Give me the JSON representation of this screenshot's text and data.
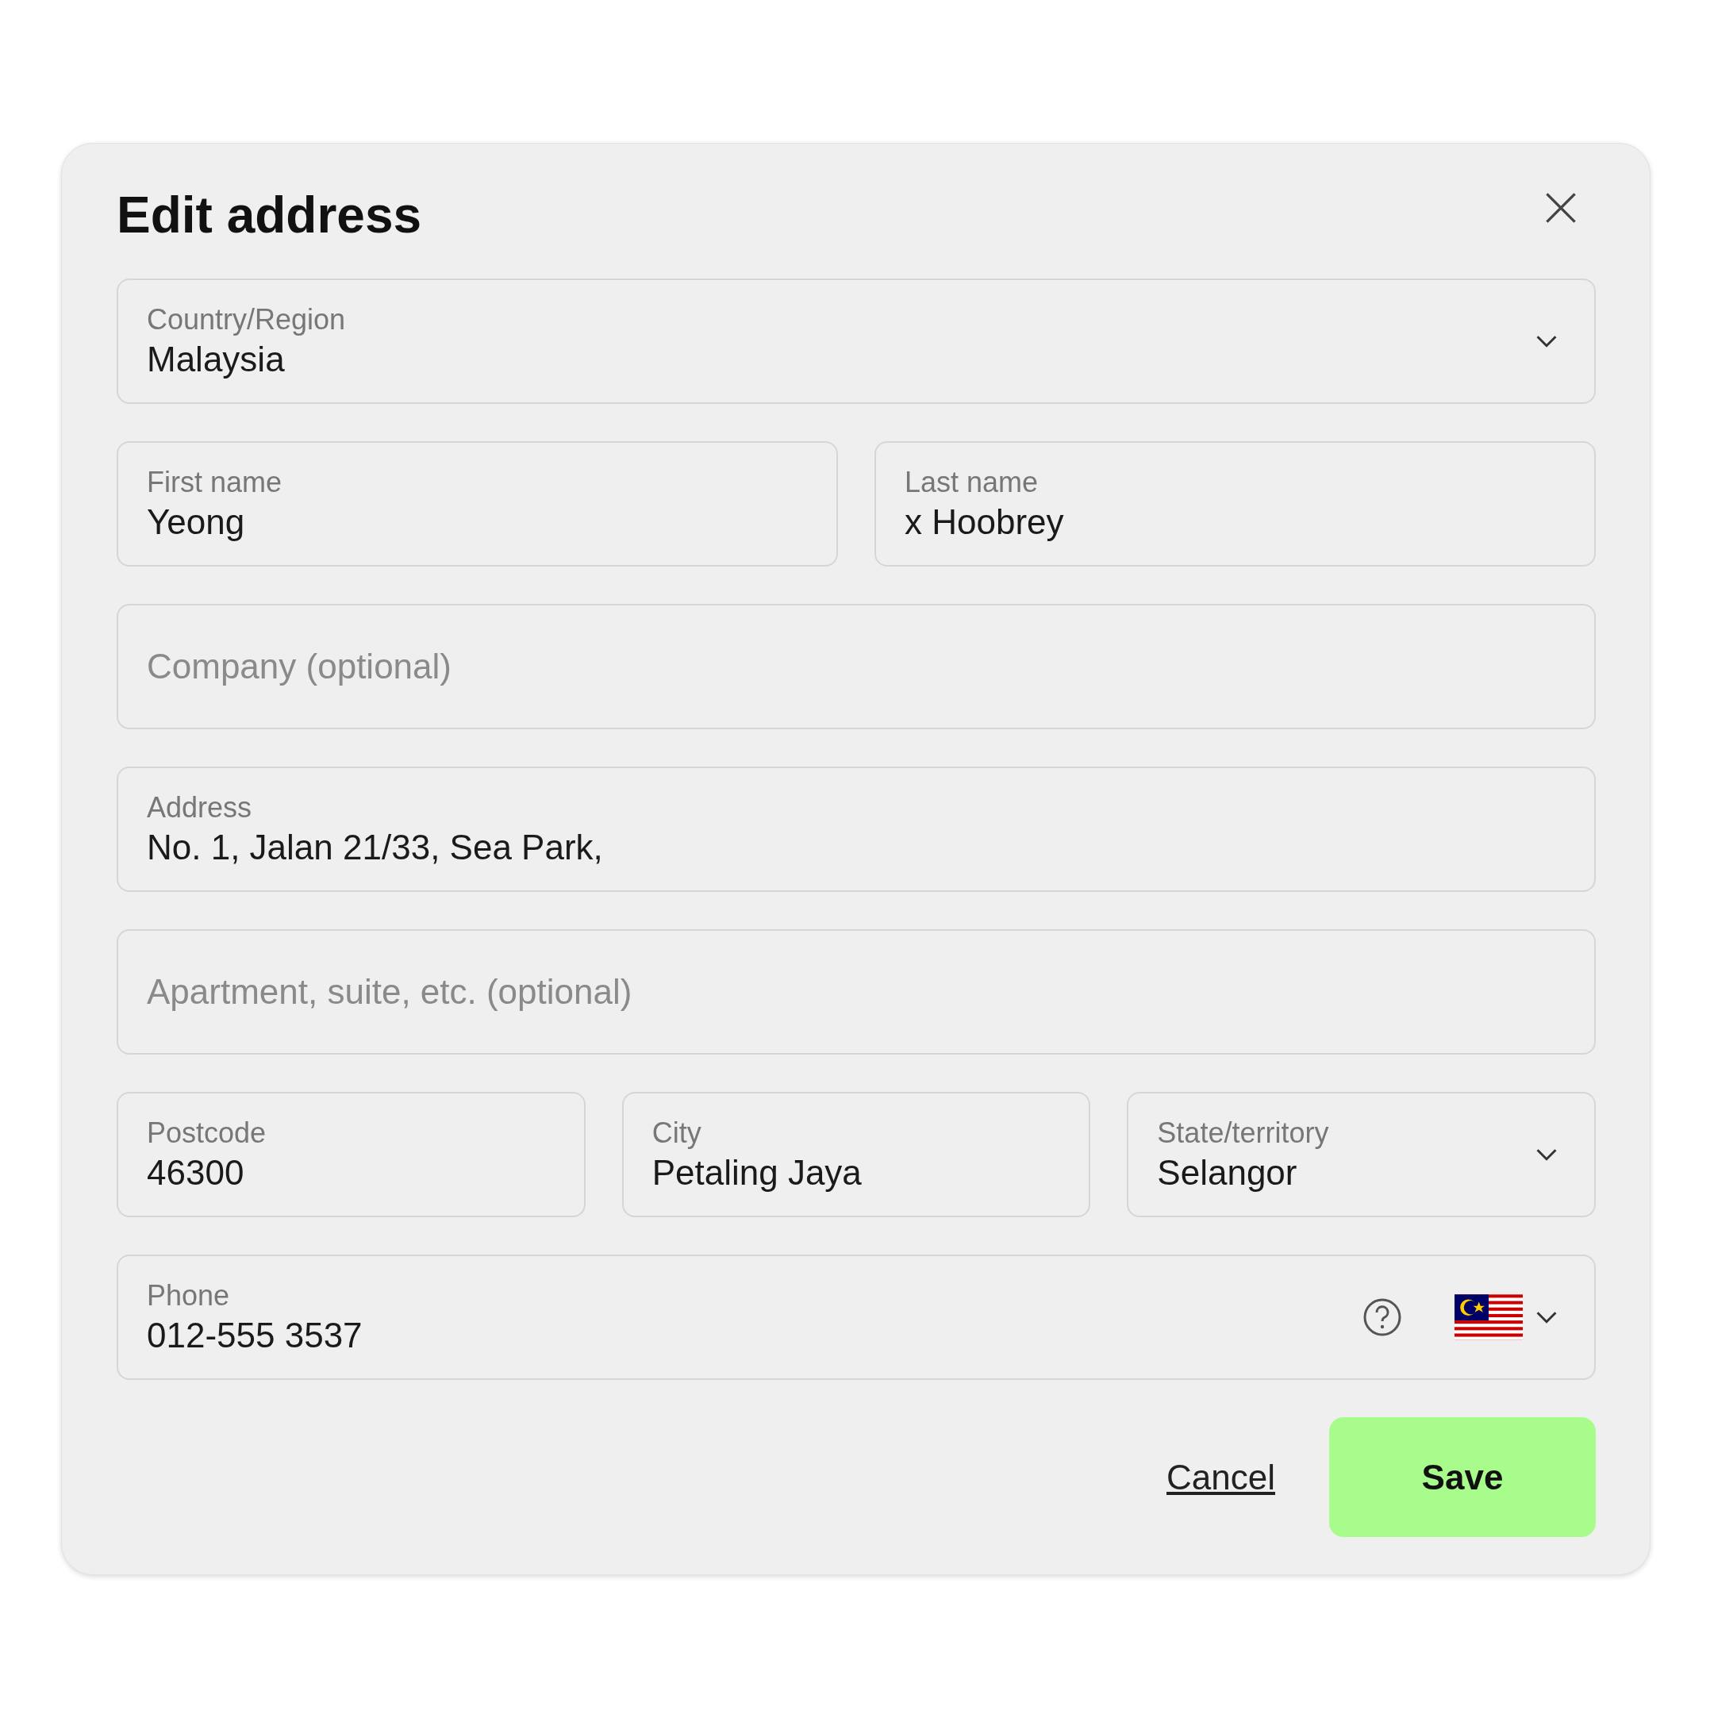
{
  "dialog": {
    "title": "Edit address",
    "rows": [
      [
        {
          "kind": "select",
          "label": "Country/Region",
          "value": "Malaysia"
        }
      ],
      [
        {
          "kind": "text",
          "label": "First name",
          "value": "Yeong"
        },
        {
          "kind": "text",
          "label": "Last name",
          "value": "x Hoobrey"
        }
      ],
      [
        {
          "kind": "text",
          "placeholder": "Company (optional)"
        }
      ],
      [
        {
          "kind": "text",
          "label": "Address",
          "value": "No. 1, Jalan 21/33, Sea Park,"
        }
      ],
      [
        {
          "kind": "text",
          "placeholder": "Apartment, suite, etc. (optional)"
        }
      ],
      [
        {
          "kind": "text",
          "label": "Postcode",
          "value": "46300"
        },
        {
          "kind": "text",
          "label": "City",
          "value": "Petaling Jaya"
        },
        {
          "kind": "select",
          "label": "State/territory",
          "value": "Selangor"
        }
      ],
      [
        {
          "kind": "phone",
          "label": "Phone",
          "value": "012-555 3537"
        }
      ]
    ],
    "cancel": "Cancel",
    "save": "Save"
  }
}
